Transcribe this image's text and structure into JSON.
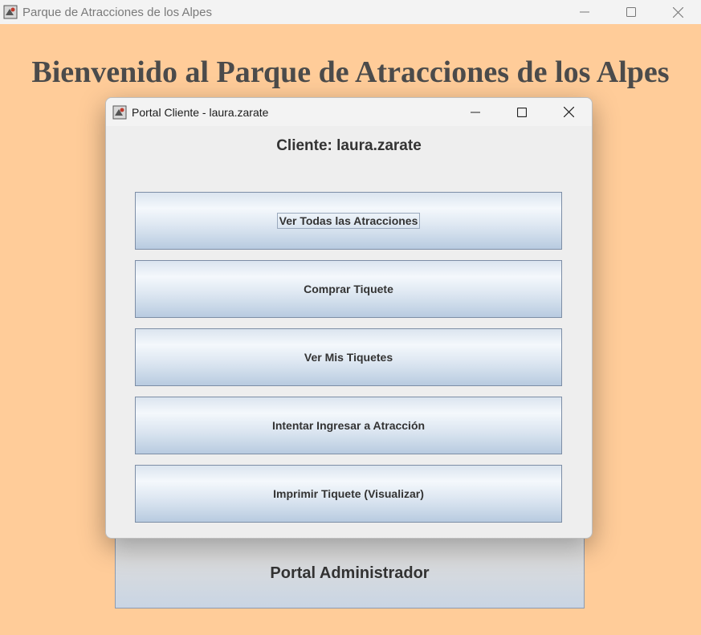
{
  "main_window": {
    "title": "Parque de Atracciones de los Alpes",
    "icon": "java-app-icon",
    "heading": "Bienvenido al Parque de Atracciones de los Alpes",
    "admin_button_label": "Portal Administrador"
  },
  "dialog": {
    "title": "Portal Cliente - laura.zarate",
    "icon": "java-app-icon",
    "client_label": "Cliente: laura.zarate",
    "buttons": [
      {
        "label": "Ver Todas las Atracciones",
        "focused": true
      },
      {
        "label": "Comprar Tiquete"
      },
      {
        "label": "Ver Mis Tiquetes"
      },
      {
        "label": "Intentar Ingresar a Atracción"
      },
      {
        "label": "Imprimir Tiquete (Visualizar)"
      }
    ]
  },
  "window_controls": [
    "minimize-icon",
    "maximize-icon",
    "close-icon"
  ],
  "colors": {
    "background": "#ffcc99",
    "heading": "#4b4b4b",
    "button_border": "#7d8ea6"
  }
}
